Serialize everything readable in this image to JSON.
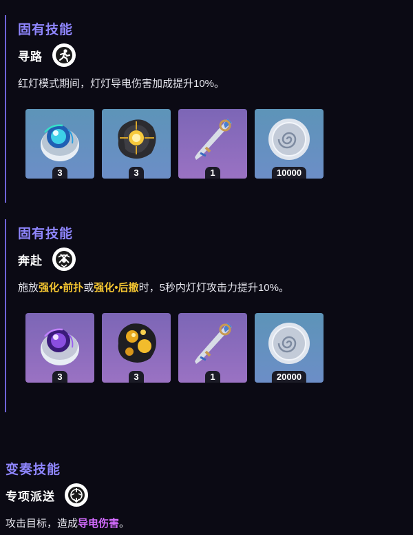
{
  "sections": [
    {
      "title": "固有技能",
      "skill_name": "寻路",
      "skill_icon": "running-figure-icon",
      "desc": {
        "parts": [
          "红灯模式期间，灯灯导电伤害加成提升10%。"
        ]
      },
      "items": [
        {
          "icon": "blue-orb-shell-icon",
          "count": "3",
          "bg": "blue"
        },
        {
          "icon": "gold-core-rock-icon",
          "count": "3",
          "bg": "blue"
        },
        {
          "icon": "ornate-spear-icon",
          "count": "1",
          "bg": "purple"
        },
        {
          "icon": "shell-coin-icon",
          "count": "10000",
          "bg": "blue"
        }
      ]
    },
    {
      "title": "固有技能",
      "skill_name": "奔赴",
      "skill_icon": "crossed-blades-icon",
      "desc": {
        "prefix": "施放",
        "hl1": "强化•前扑",
        "mid": "或",
        "hl2": "强化•后撤",
        "suffix": "时，5秒内灯灯攻击力提升10%。"
      },
      "items": [
        {
          "icon": "purple-orb-shell-icon",
          "count": "3",
          "bg": "purple"
        },
        {
          "icon": "gold-spotted-rock-icon",
          "count": "3",
          "bg": "purple"
        },
        {
          "icon": "ornate-spear-icon",
          "count": "1",
          "bg": "purple"
        },
        {
          "icon": "shell-coin-icon",
          "count": "20000",
          "bg": "blue"
        }
      ]
    },
    {
      "title": "变奏技能",
      "skill_name": "专项派送",
      "skill_icon": "ring-burst-icon",
      "desc": {
        "prefix": "攻击目标，造成",
        "hl": "导电伤害",
        "suffix": "。"
      }
    }
  ],
  "colors": {
    "background": "#0b0a14",
    "title": "#8f86ff",
    "accent_bar": "#6f63d8",
    "highlight_yellow": "#f3c531",
    "highlight_purple": "#d46cff"
  }
}
